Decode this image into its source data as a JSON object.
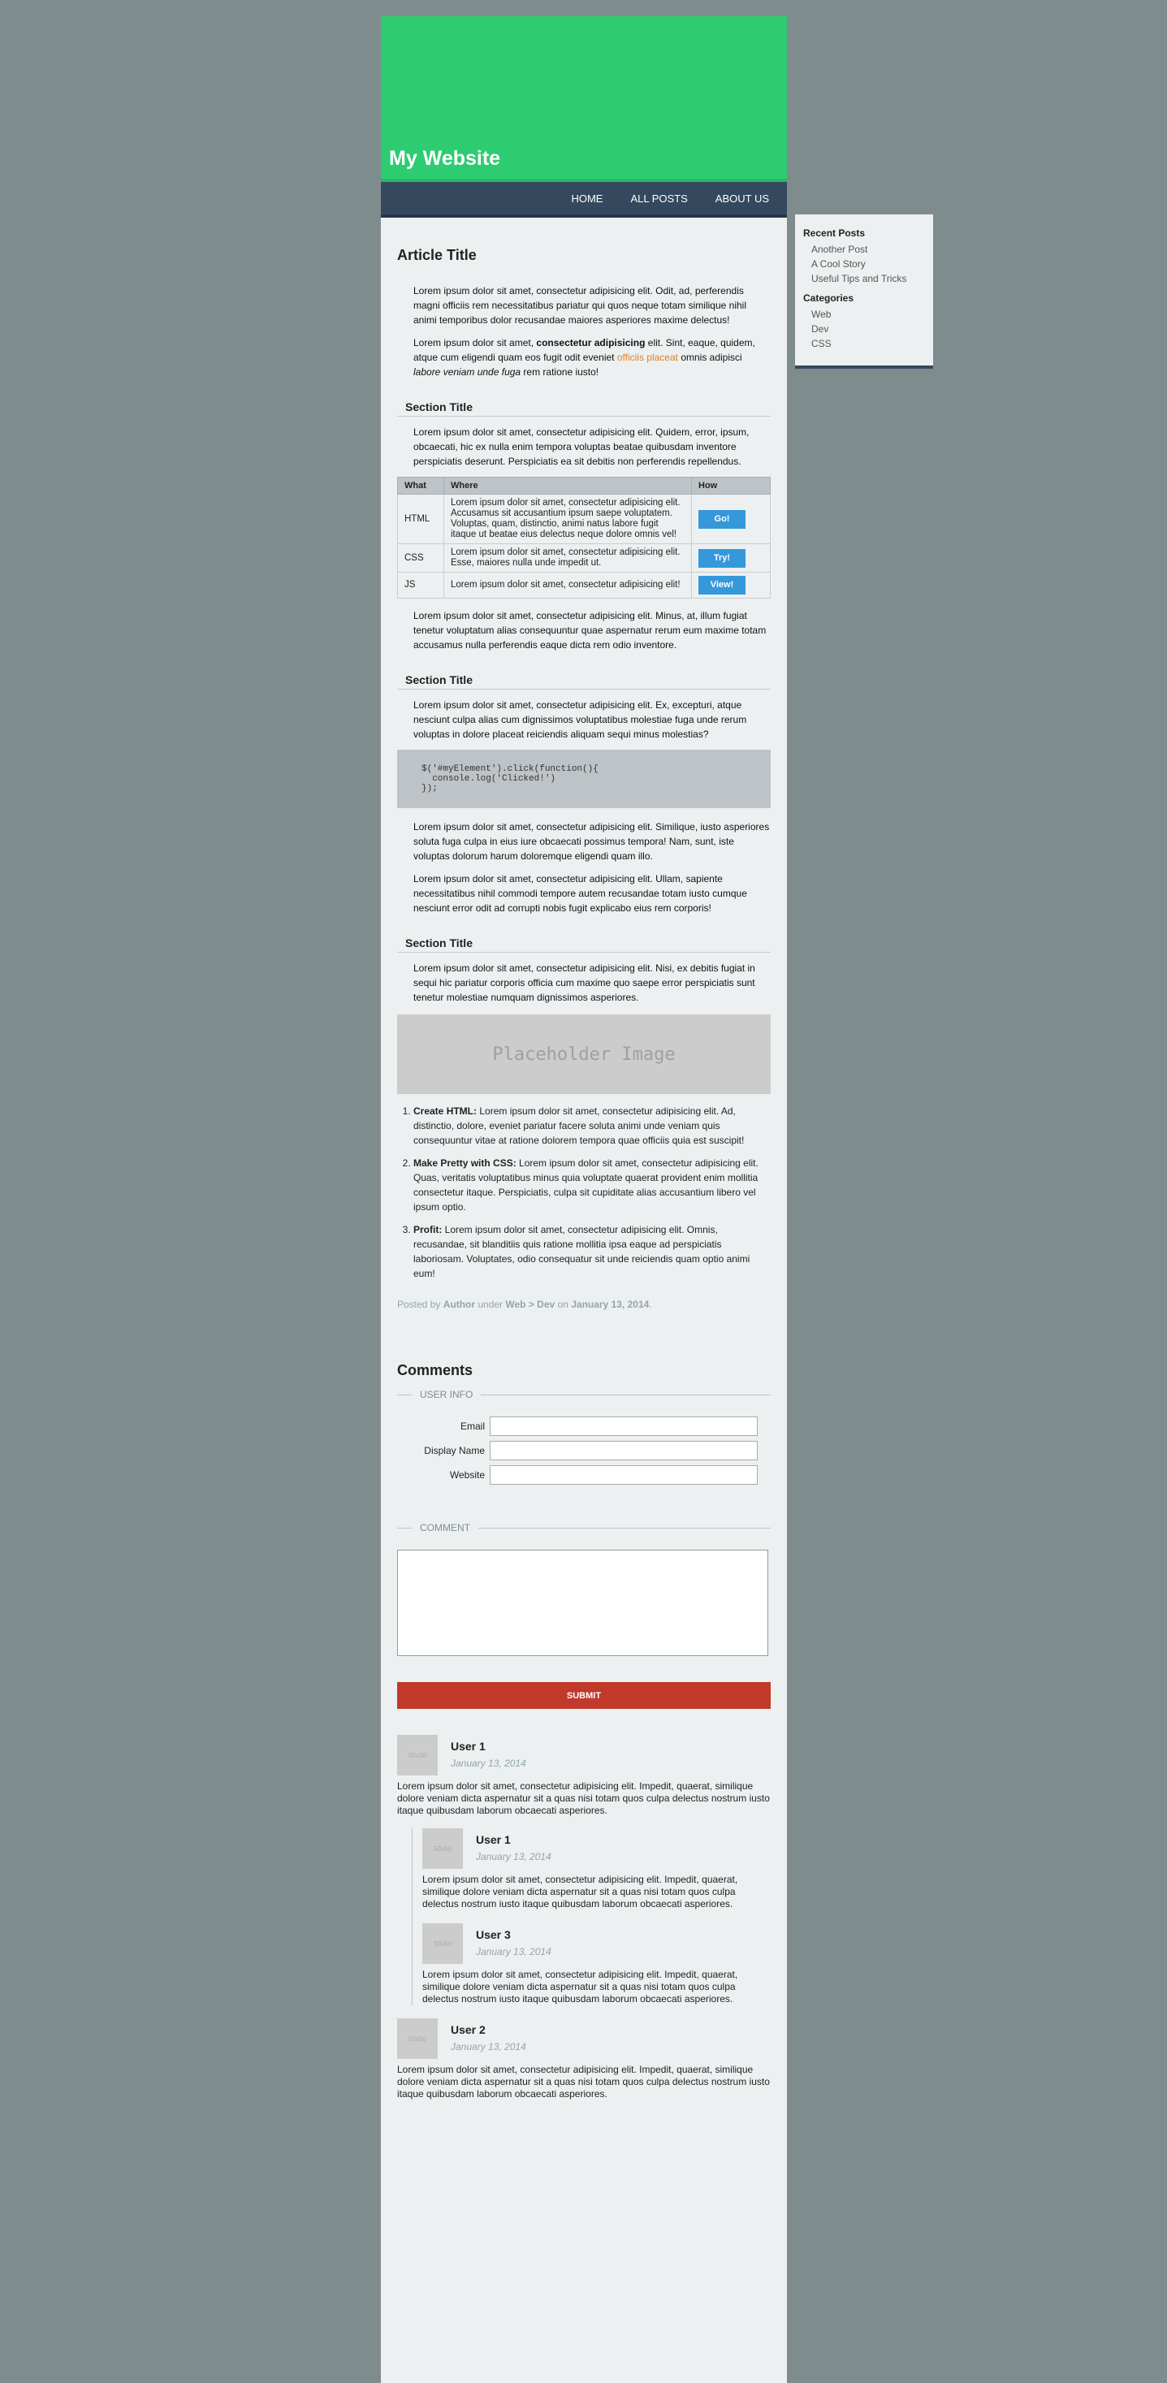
{
  "header": {
    "site_title": "My Website"
  },
  "nav": {
    "items": [
      "HOME",
      "ALL POSTS",
      "ABOUT US"
    ]
  },
  "article": {
    "title": "Article Title",
    "intro_p1": "Lorem ipsum dolor sit amet, consectetur adipisicing elit. Odit, ad, perferendis magni officiis rem necessitatibus pariatur qui quos neque totam similique nihil animi temporibus dolor recusandae maiores asperiores maxime delectus!",
    "intro_p2_a": "Lorem ipsum dolor sit amet, ",
    "intro_p2_bold": "consectetur adipisicing",
    "intro_p2_b": " elit. Sint, eaque, quidem, atque cum eligendi quam eos fugit odit eveniet ",
    "intro_p2_link": "officiis placeat",
    "intro_p2_c": " omnis adipisci ",
    "intro_p2_italic": "labore veniam unde fuga",
    "intro_p2_d": " rem ratione iusto!",
    "section1_title": "Section Title",
    "section1_p1": "Lorem ipsum dolor sit amet, consectetur adipisicing elit. Quidem, error, ipsum, obcaecati, hic ex nulla enim tempora voluptas beatae quibusdam inventore perspiciatis deserunt. Perspiciatis ea sit debitis non perferendis repellendus.",
    "table": {
      "headers": [
        "What",
        "Where",
        "How"
      ],
      "rows": [
        {
          "what": "HTML",
          "where": "Lorem ipsum dolor sit amet, consectetur adipisicing elit. Accusamus sit accusantium ipsum saepe voluptatem. Voluptas, quam, distinctio, animi natus labore fugit itaque ut beatae eius delectus neque dolore omnis vel!",
          "how": "Go!"
        },
        {
          "what": "CSS",
          "where": "Lorem ipsum dolor sit amet, consectetur adipisicing elit. Esse, maiores nulla unde impedit ut.",
          "how": "Try!"
        },
        {
          "what": "JS",
          "where": "Lorem ipsum dolor sit amet, consectetur adipisicing elit!",
          "how": "View!"
        }
      ]
    },
    "section1_p2": "Lorem ipsum dolor sit amet, consectetur adipisicing elit. Minus, at, illum fugiat tenetur voluptatum alias consequuntur quae aspernatur rerum eum maxime totam accusamus nulla perferendis eaque dicta rem odio inventore.",
    "section2_title": "Section Title",
    "section2_p1": "Lorem ipsum dolor sit amet, consectetur adipisicing elit. Ex, excepturi, atque nesciunt culpa alias cum dignissimos voluptatibus molestiae fuga unde rerum voluptas in dolore placeat reiciendis aliquam sequi minus molestias?",
    "code": "$('#myElement').click(function(){\n  console.log('Clicked!')\n});",
    "section2_p2": "Lorem ipsum dolor sit amet, consectetur adipisicing elit. Similique, iusto asperiores soluta fuga culpa in eius iure obcaecati possimus tempora! Nam, sunt, iste voluptas dolorum harum doloremque eligendi quam illo.",
    "section2_p3": "Lorem ipsum dolor sit amet, consectetur adipisicing elit. Ullam, sapiente necessitatibus nihil commodi tempore autem recusandae totam iusto cumque nesciunt error odit ad corrupti nobis fugit explicabo eius rem corporis!",
    "section3_title": "Section Title",
    "section3_p1": "Lorem ipsum dolor sit amet, consectetur adipisicing elit. Nisi, ex debitis fugiat in sequi hic pariatur corporis officia cum maxime quo saepe error perspiciatis sunt tenetur molestiae numquam dignissimos asperiores.",
    "placeholder_text": "Placeholder Image",
    "steps": [
      {
        "bold": "Create HTML:",
        "text": " Lorem ipsum dolor sit amet, consectetur adipisicing elit. Ad, distinctio, dolore, eveniet pariatur facere soluta animi unde veniam quis consequuntur vitae at ratione dolorem tempora quae officiis quia est suscipit!"
      },
      {
        "bold": "Make Pretty with CSS:",
        "text": " Lorem ipsum dolor sit amet, consectetur adipisicing elit. Quas, veritatis voluptatibus minus quia voluptate quaerat provident enim mollitia consectetur itaque. Perspiciatis, culpa sit cupiditate alias accusantium libero vel ipsum optio."
      },
      {
        "bold": "Profit:",
        "text": " Lorem ipsum dolor sit amet, consectetur adipisicing elit. Omnis, recusandae, sit blanditiis quis ratione mollitia ipsa eaque ad perspiciatis laboriosam. Voluptates, odio consequatur sit unde reiciendis quam optio animi eum!"
      }
    ],
    "meta": {
      "posted_by": "Posted by ",
      "author": "Author",
      "under": " under ",
      "category": "Web > Dev",
      "on": " on ",
      "date": "January 13, 2014",
      "end": "."
    }
  },
  "comments": {
    "title": "Comments",
    "user_info_legend": "USER INFO",
    "email_label": "Email",
    "display_name_label": "Display Name",
    "website_label": "Website",
    "comment_legend": "COMMENT",
    "submit_label": "SUBMIT",
    "avatar_text": "50x50",
    "items": [
      {
        "name": "User 1",
        "date": "January 13, 2014",
        "text": "Lorem ipsum dolor sit amet, consectetur adipisicing elit. Impedit, quaerat, similique dolore veniam dicta aspernatur sit a quas nisi totam quos culpa delectus nostrum iusto itaque quibusdam laborum obcaecati asperiores."
      },
      {
        "name": "User 1",
        "date": "January 13, 2014",
        "text": "Lorem ipsum dolor sit amet, consectetur adipisicing elit. Impedit, quaerat, similique dolore veniam dicta aspernatur sit a quas nisi totam quos culpa delectus nostrum iusto itaque quibusdam laborum obcaecati asperiores."
      },
      {
        "name": "User 3",
        "date": "January 13, 2014",
        "text": "Lorem ipsum dolor sit amet, consectetur adipisicing elit. Impedit, quaerat, similique dolore veniam dicta aspernatur sit a quas nisi totam quos culpa delectus nostrum iusto itaque quibusdam laborum obcaecati asperiores."
      },
      {
        "name": "User 2",
        "date": "January 13, 2014",
        "text": "Lorem ipsum dolor sit amet, consectetur adipisicing elit. Impedit, quaerat, similique dolore veniam dicta aspernatur sit a quas nisi totam quos culpa delectus nostrum iusto itaque quibusdam laborum obcaecati asperiores."
      }
    ]
  },
  "sidebar": {
    "recent_title": "Recent Posts",
    "recent": [
      "Another Post",
      "A Cool Story",
      "Useful Tips and Tricks"
    ],
    "categories_title": "Categories",
    "categories": [
      "Web",
      "Dev",
      "CSS"
    ]
  },
  "colors": {
    "header": "#2ecc71",
    "nav": "#34495e",
    "background": "#7f8c8d",
    "content": "#ecf0f1",
    "button_blue": "#3498db",
    "submit_red": "#c0392b",
    "link_orange": "#e67e22"
  }
}
